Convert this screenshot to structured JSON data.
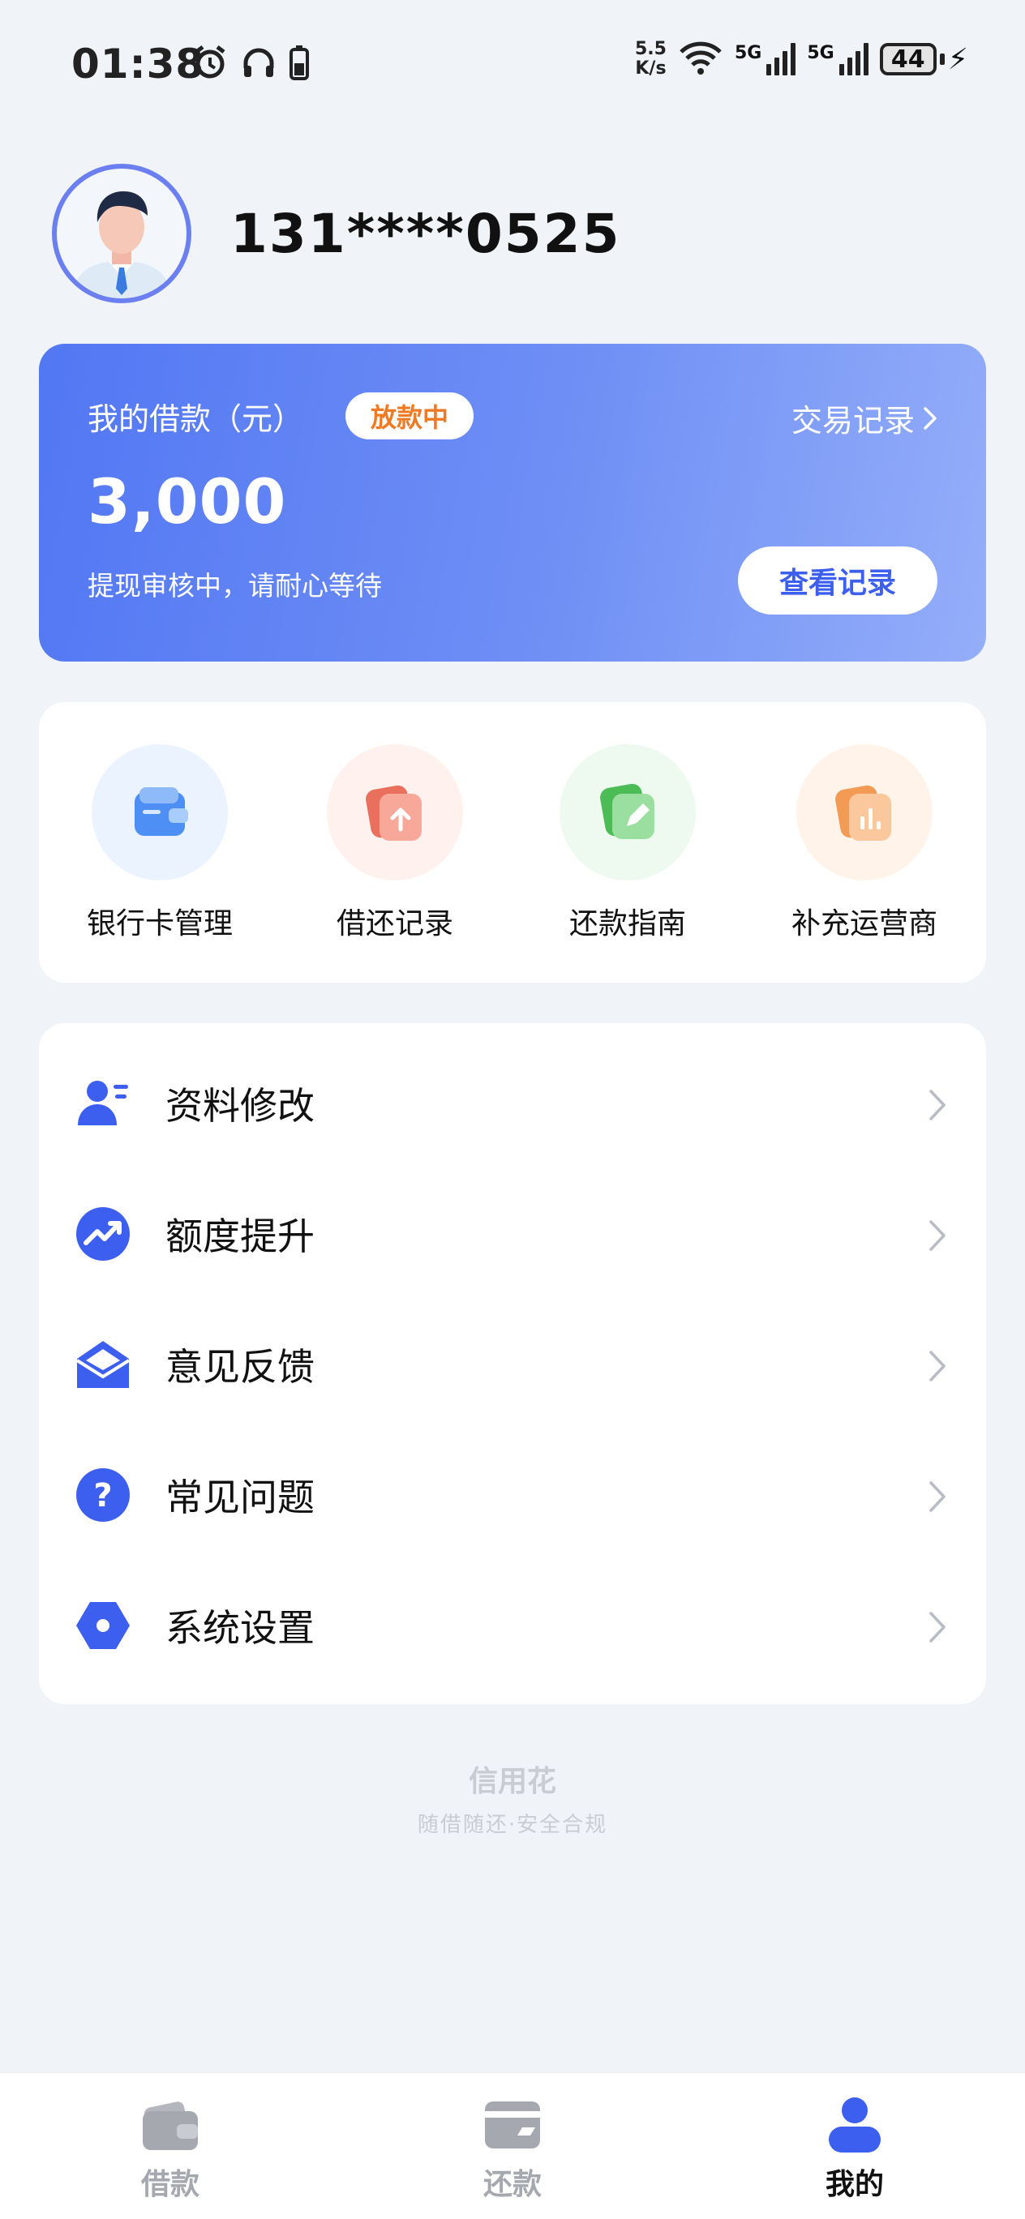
{
  "status_bar": {
    "time": "01:38",
    "net_speed_value": "5.5",
    "net_speed_unit": "K/s",
    "sim1_label": "5G",
    "sim2_label": "5G",
    "battery_level": "44"
  },
  "profile": {
    "phone": "131****0525"
  },
  "loan_card": {
    "title": "我的借款（元）",
    "badge": "放款中",
    "transactions_link": "交易记录",
    "amount": "3,000",
    "subtitle": "提现审核中，请耐心等待",
    "view_button": "查看记录"
  },
  "quick_actions": [
    {
      "label": "银行卡管理",
      "icon": "wallet-icon",
      "color": "#4d8ff5"
    },
    {
      "label": "借还记录",
      "icon": "upload-icon",
      "color": "#f07460"
    },
    {
      "label": "还款指南",
      "icon": "edit-icon",
      "color": "#4cc25a"
    },
    {
      "label": "补充运营商",
      "icon": "chart-icon",
      "color": "#f5a15e"
    }
  ],
  "menu": [
    {
      "label": "资料修改",
      "icon": "user-profile-icon"
    },
    {
      "label": "额度提升",
      "icon": "trend-up-icon"
    },
    {
      "label": "意见反馈",
      "icon": "mail-open-icon"
    },
    {
      "label": "常见问题",
      "icon": "question-icon"
    },
    {
      "label": "系统设置",
      "icon": "settings-hex-icon"
    }
  ],
  "footer": {
    "brand": "信用花",
    "slogan": "随借随还·安全合规"
  },
  "tabs": [
    {
      "label": "借款",
      "icon": "wallet-icon",
      "active": false
    },
    {
      "label": "还款",
      "icon": "card-icon",
      "active": false
    },
    {
      "label": "我的",
      "icon": "person-icon",
      "active": true
    }
  ],
  "colors": {
    "accent": "#3d5ff0",
    "badge_text": "#f07a24",
    "background": "#f0f3f8"
  }
}
